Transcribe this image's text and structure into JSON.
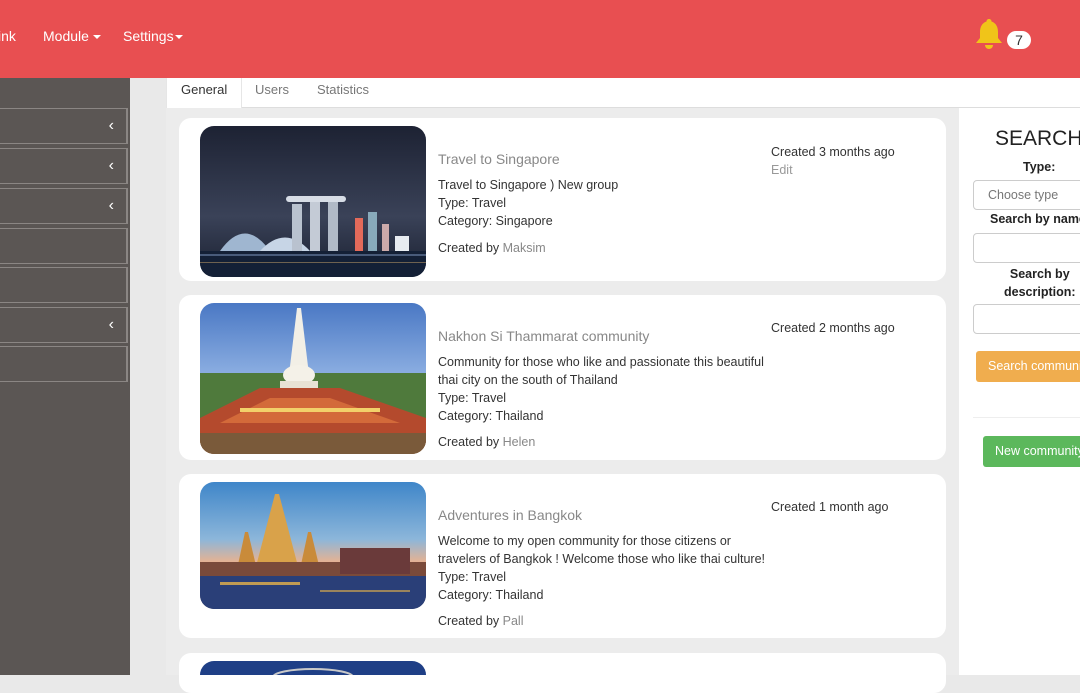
{
  "header": {
    "nav": {
      "link_partial": "ink",
      "module_label": "Module",
      "settings_label": "Settings"
    },
    "notification_count": "7",
    "bell_icon": "bell-icon",
    "accent_color": "#e84f51"
  },
  "sidebar": {
    "items": [
      {
        "label": "",
        "has_chevron": true
      },
      {
        "label": "",
        "has_chevron": true
      },
      {
        "label": "",
        "has_chevron": true
      },
      {
        "label": "",
        "has_chevron": false
      },
      {
        "label": "",
        "has_chevron": false
      },
      {
        "label": "",
        "has_chevron": true
      },
      {
        "label": "",
        "has_chevron": false
      }
    ],
    "chevron_glyph": "‹"
  },
  "tabs": [
    {
      "label": "General",
      "active": true
    },
    {
      "label": "Users",
      "active": false
    },
    {
      "label": "Statistics",
      "active": false
    }
  ],
  "communities": [
    {
      "title": "Travel to Singapore",
      "description": "Travel to Singapore ) New group",
      "type": "Type: Travel",
      "category": "Category: Singapore",
      "created_by_label": "Created by",
      "author": "Maksim",
      "created": "Created 3 months ago",
      "edit_label": "Edit"
    },
    {
      "title": "Nakhon Si Thammarat community",
      "description_line1": "Community for those who like and passionate this beautiful",
      "description_line2": "thai city on the south of Thailand",
      "type": "Type: Travel",
      "category": "Category: Thailand",
      "created_by_label": "Created by",
      "author": "Helen",
      "created": "Created 2 months ago"
    },
    {
      "title": "Adventures in Bangkok",
      "description_line1": "Welcome to my open community for those citizens or",
      "description_line2": "travelers of Bangkok ! Welcome those who like thai culture!",
      "type": "Type: Travel",
      "category": "Category: Thailand",
      "created_by_label": "Created by",
      "author": "Pall",
      "created": "Created 1 month ago"
    }
  ],
  "search_panel": {
    "title": "SEARCH",
    "type_label": "Type:",
    "type_placeholder": "Choose type",
    "name_label": "Search by name",
    "description_label_line1": "Search by",
    "description_label_line2": "description:",
    "search_button": "Search community",
    "new_button": "New community"
  },
  "colors": {
    "warning": "#f0ad4e",
    "success": "#5cb85c",
    "sidebar": "#5b5654"
  }
}
